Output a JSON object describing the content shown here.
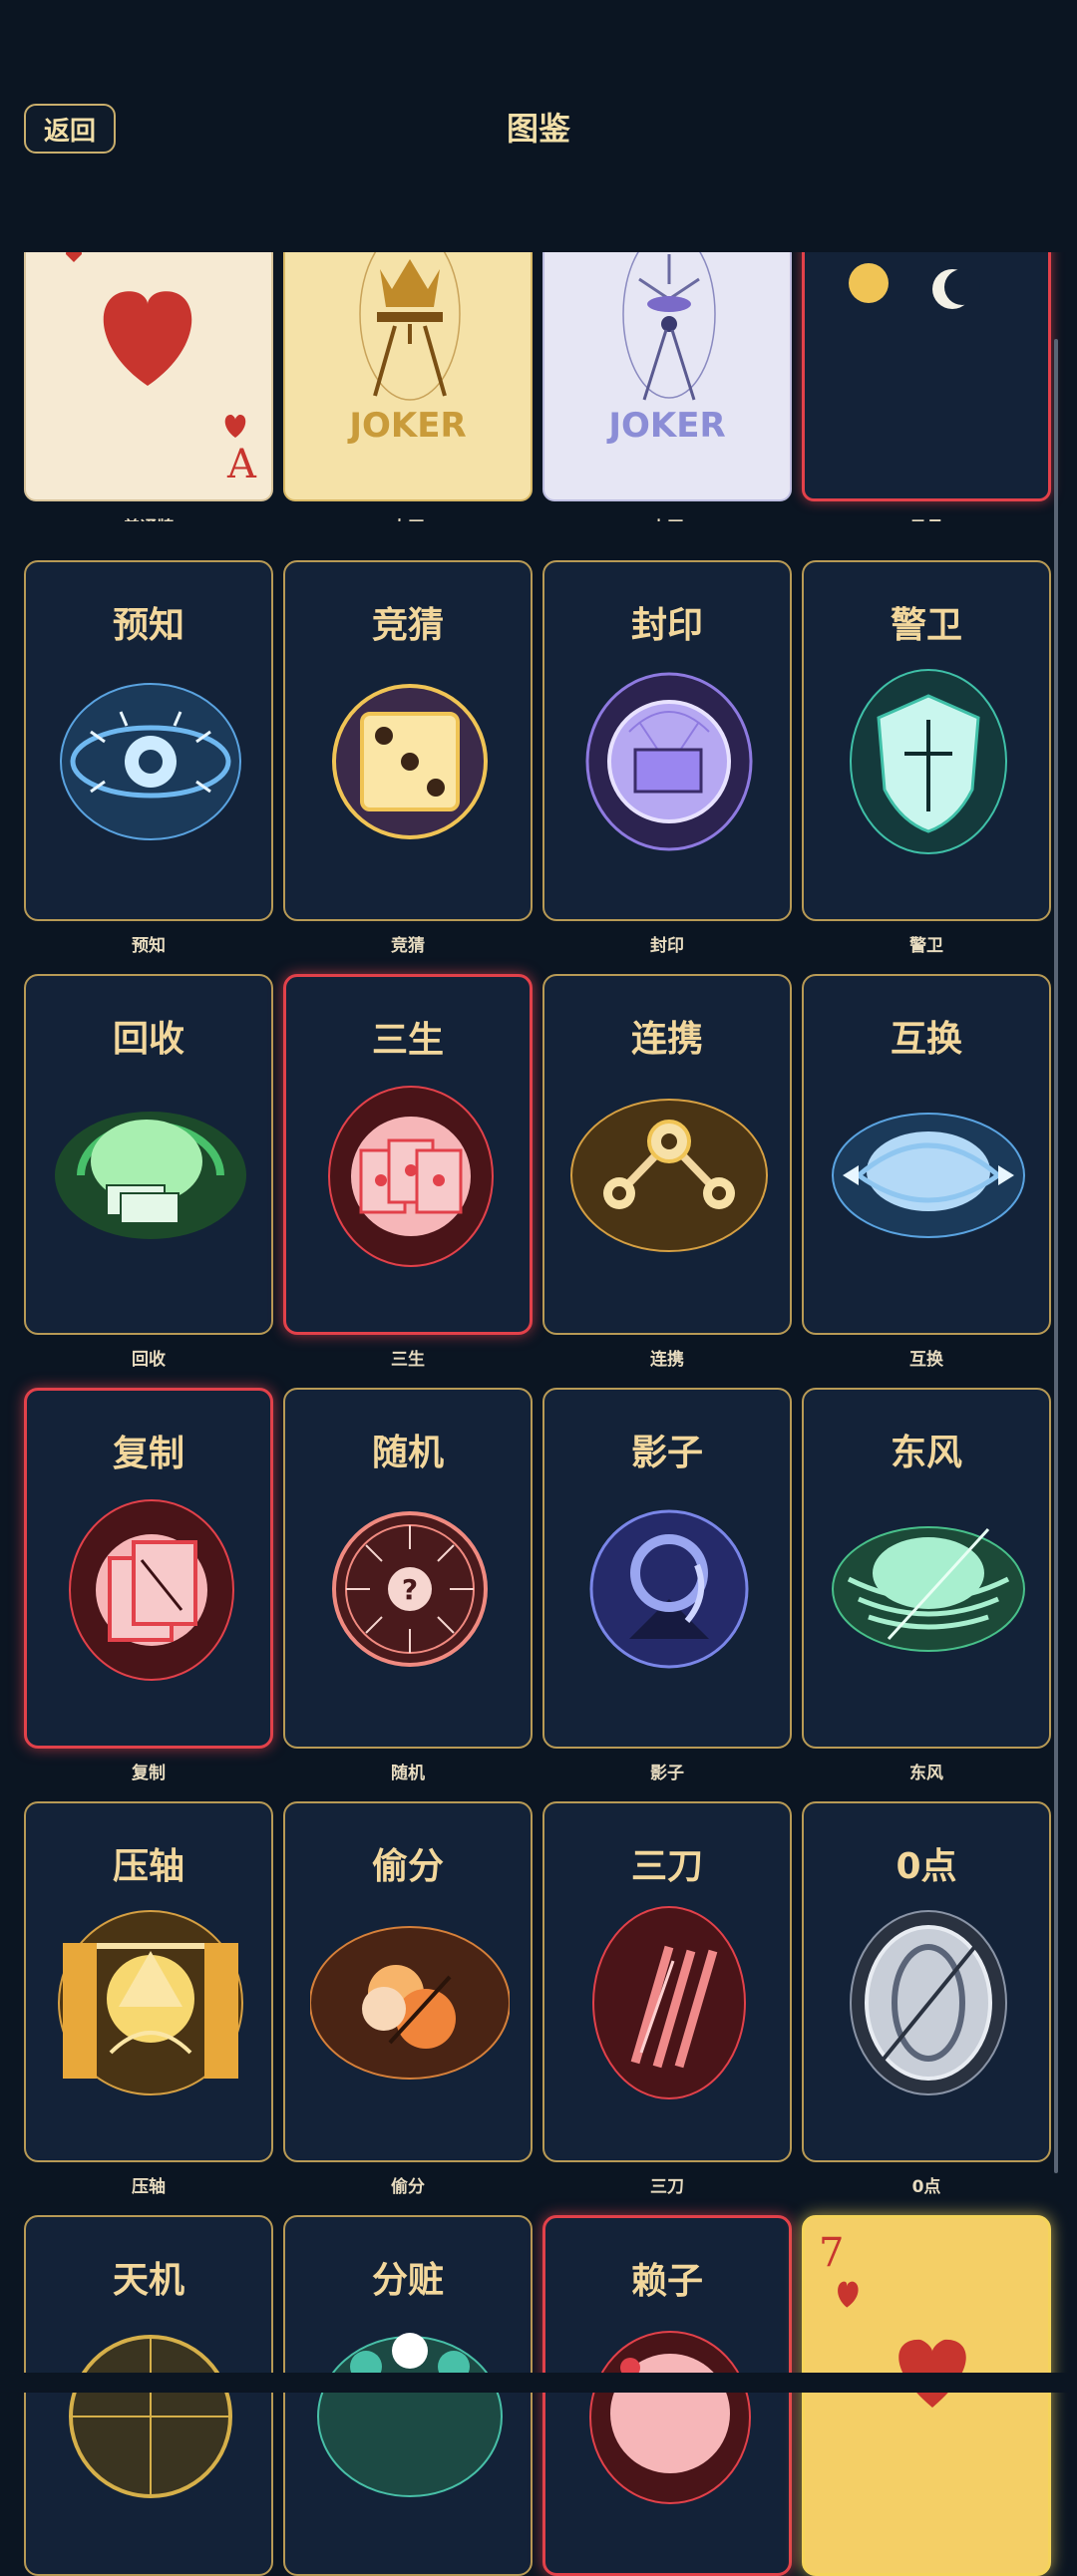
{
  "header": {
    "back_label": "返回",
    "title": "图鉴"
  },
  "top_row": {
    "normal": {
      "caption": "普通牌",
      "rank": "A"
    },
    "big_joker": {
      "caption": "大王",
      "label": "JOKER"
    },
    "small_joker": {
      "caption": "小王",
      "label": "JOKER"
    },
    "sun_moon": {
      "caption": "日月"
    }
  },
  "cards": [
    {
      "title": "预知",
      "caption": "预知",
      "icon": "eye-icon"
    },
    {
      "title": "竞猜",
      "caption": "竞猜",
      "icon": "dice-icon"
    },
    {
      "title": "封印",
      "caption": "封印",
      "icon": "seal-icon"
    },
    {
      "title": "警卫",
      "caption": "警卫",
      "icon": "shield-icon"
    },
    {
      "title": "回收",
      "caption": "回收",
      "icon": "recycle-icon"
    },
    {
      "title": "三生",
      "caption": "三生",
      "icon": "three-cards-icon"
    },
    {
      "title": "连携",
      "caption": "连携",
      "icon": "link-icon"
    },
    {
      "title": "互换",
      "caption": "互换",
      "icon": "swap-icon"
    },
    {
      "title": "复制",
      "caption": "复制",
      "icon": "copy-icon"
    },
    {
      "title": "随机",
      "caption": "随机",
      "icon": "random-dial-icon"
    },
    {
      "title": "影子",
      "caption": "影子",
      "icon": "shadow-icon"
    },
    {
      "title": "东风",
      "caption": "东风",
      "icon": "wind-icon"
    },
    {
      "title": "压轴",
      "caption": "压轴",
      "icon": "finale-icon"
    },
    {
      "title": "偷分",
      "caption": "偷分",
      "icon": "steal-icon"
    },
    {
      "title": "三刀",
      "caption": "三刀",
      "icon": "three-blades-icon"
    },
    {
      "title": "0点",
      "caption": "0点",
      "icon": "zero-icon"
    },
    {
      "title": "天机",
      "caption": "",
      "icon": "compass-icon"
    },
    {
      "title": "分赃",
      "caption": "",
      "icon": "split-icon"
    },
    {
      "title": "赖子",
      "caption": "",
      "icon": "wildcard-icon"
    }
  ],
  "bottom_card": {
    "rank": "7"
  }
}
